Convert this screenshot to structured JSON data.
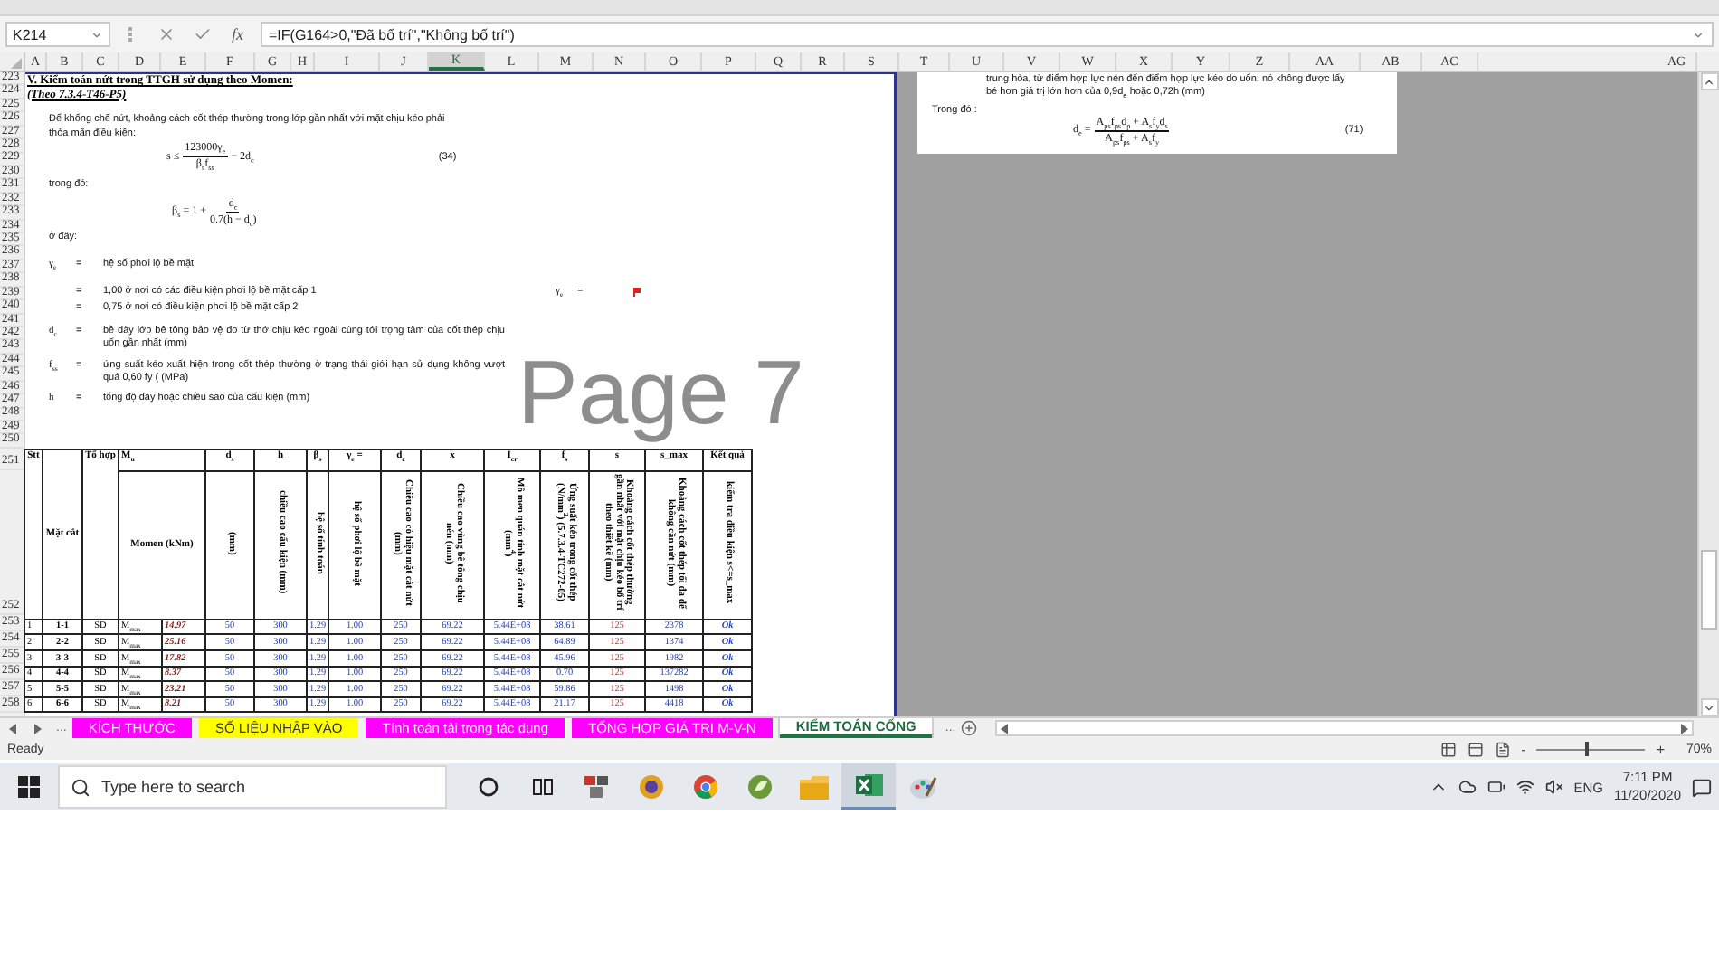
{
  "name_box": {
    "value": "K214"
  },
  "formula_bar": {
    "function_label": "fx",
    "formula": "=IF(G164>0,\"Đã bố trí\",\"Không bố trí\")"
  },
  "columns": [
    {
      "label": "A",
      "selected": false
    },
    {
      "label": "B",
      "selected": false
    },
    {
      "label": "C",
      "selected": false
    },
    {
      "label": "D",
      "selected": false
    },
    {
      "label": "E",
      "selected": false
    },
    {
      "label": "F",
      "selected": false
    },
    {
      "label": "G",
      "selected": false
    },
    {
      "label": "H",
      "selected": false
    },
    {
      "label": "I",
      "selected": false
    },
    {
      "label": "J",
      "selected": false
    },
    {
      "label": "K",
      "selected": true
    },
    {
      "label": "L",
      "selected": false
    },
    {
      "label": "M",
      "selected": false
    },
    {
      "label": "N",
      "selected": false
    },
    {
      "label": "O",
      "selected": false
    },
    {
      "label": "P",
      "selected": false
    },
    {
      "label": "Q",
      "selected": false
    },
    {
      "label": "R",
      "selected": false
    },
    {
      "label": "S",
      "selected": false
    },
    {
      "label": "T",
      "selected": false
    },
    {
      "label": "U",
      "selected": false
    },
    {
      "label": "V",
      "selected": false
    },
    {
      "label": "W",
      "selected": false
    },
    {
      "label": "X",
      "selected": false
    },
    {
      "label": "Y",
      "selected": false
    },
    {
      "label": "Z",
      "selected": false
    },
    {
      "label": "AA",
      "selected": false
    },
    {
      "label": "AB",
      "selected": false
    },
    {
      "label": "AC",
      "selected": false
    },
    {
      "label": "AG",
      "selected": false
    }
  ],
  "row_numbers": [
    "223",
    "224",
    "225",
    "226",
    "227",
    "228",
    "229",
    "230",
    "231",
    "232",
    "233",
    "234",
    "235",
    "236",
    "237",
    "238",
    "239",
    "240",
    "241",
    "242",
    "243",
    "244",
    "245",
    "246",
    "247",
    "248",
    "249",
    "250",
    "251",
    "252",
    "253",
    "254",
    "255",
    "256",
    "257",
    "258"
  ],
  "notes": [
    {
      "kind": "heading",
      "text": "V. Kiểm toán nứt trong TTGH sử dụng theo Momen:"
    },
    {
      "kind": "subheading",
      "text": "(Theo 7.3.4-T46-P5)"
    },
    {
      "kind": "paragraph",
      "text": "Để khống chế nứt, khoảng cách cốt thép thường trong lớp gần nhất với mặt chịu kéo phải"
    },
    {
      "kind": "paragraph",
      "text": "thỏa mãn điều kiện:"
    },
    {
      "kind": "formula",
      "lhs": "s ≤",
      "numerator": "123000γ$_{e}$",
      "denominator": "β$_{s}$f$_{ss}$",
      "rhs": "− 2d$_{c}$",
      "number": "(34)"
    },
    {
      "kind": "paragraph",
      "text": "trong đó:"
    },
    {
      "kind": "formula",
      "lhs": "β$_{s}$ = 1 +",
      "numerator": "d$_{c}$",
      "denominator": "0.7(h − d$_{c}$)"
    },
    {
      "kind": "paragraph",
      "text": "ở đây:"
    },
    {
      "kind": "definition",
      "symbol": "γ$_{e}$",
      "eq": "=",
      "text": "hệ số phơi lộ bề mặt"
    },
    {
      "kind": "definition",
      "eq": "=",
      "text": "1,00 ở nơi có các điều kiện phơi lộ bề mặt cấp 1",
      "side": {
        "symbol": "γ$_{e}$",
        "eq": "="
      }
    },
    {
      "kind": "definition",
      "eq": "=",
      "text": "0,75 ở nơi có điều kiện phơi lộ bề mặt cấp 2"
    },
    {
      "kind": "definition",
      "symbol": "d$_{c}$",
      "eq": "=",
      "text": "bề dày lớp bê tông bảo vệ đo từ thớ chịu kéo ngoài cùng tới trọng tâm của cốt thép chịu uốn gần nhất (mm)"
    },
    {
      "kind": "definition",
      "symbol": "f$_{ss}$",
      "eq": "=",
      "text": "ứng suất kéo xuất hiện trong cốt thép thường ở trạng thái giới hạn sử dụng không vượt quá 0,60 fy ( (MPa)"
    },
    {
      "kind": "definition",
      "symbol": "h",
      "eq": "=",
      "text": "tổng độ dày hoặc chiều sao của cấu kiện (mm)"
    }
  ],
  "page_label": "Page 7",
  "table": {
    "headers": [
      {
        "kind": "label",
        "symbol": "Stt"
      },
      {
        "kind": "title",
        "symbol": "Mặt cắt"
      },
      {
        "kind": "label",
        "symbol": "Tổ hợp"
      },
      {
        "kind": "merged",
        "symbol": "M$_{u}$",
        "description": "Momen (kNm)"
      },
      {
        "kind": "vertical",
        "symbol": "d$_{s}$",
        "description": "(mm)"
      },
      {
        "kind": "vertical",
        "symbol": "h",
        "description": "chiều cao cấu kiện (mm)"
      },
      {
        "kind": "vertical",
        "symbol": "β$_{s}$",
        "description": "hệ số tính toán"
      },
      {
        "kind": "vertical",
        "symbol": "γ$_{e}$ =",
        "description": "hệ số phơi lộ bề mặt"
      },
      {
        "kind": "vertical",
        "symbol": "d$_{c}$",
        "description": "Chiều cao có hiệu mặt cắt nứt (mm)"
      },
      {
        "kind": "vertical",
        "symbol": "x",
        "description": "Chiều cao vùng bê tông chịu nén (mm)"
      },
      {
        "kind": "vertical",
        "symbol": "I$_{cr}$",
        "description": "Mô men quán tính mặt cắt nứt (mm$^{4}$)"
      },
      {
        "kind": "vertical",
        "symbol": "f$_{s}$",
        "description": "Ứng suất kéo trong cốt thép (N/mm$^{2}$) (5.7.3.4-TC272-05)"
      },
      {
        "kind": "vertical",
        "symbol": "s",
        "description": "Khoảng cách cốt thép thường gần nhất với mặt chịu kéo bố trí theo thiết kế (mm)"
      },
      {
        "kind": "vertical",
        "symbol": "s_max",
        "description": "Khoảng cách cốt thép tối đa để không cần nứt (mm)"
      },
      {
        "kind": "vertical",
        "symbol": "Kết quả",
        "description": "kiểm tra điều kiện s<=s_max"
      }
    ],
    "rows": [
      [
        "1",
        "1-1",
        "SD",
        "M$_{max}$",
        "14.97",
        "50",
        "300",
        "1.29",
        "1.00",
        "250",
        "69.22",
        "5.44E+08",
        "38.61",
        "125",
        "2378",
        "Ok"
      ],
      [
        "2",
        "2-2",
        "SD",
        "M$_{max}$",
        "25.16",
        "50",
        "300",
        "1.29",
        "1.00",
        "250",
        "69.22",
        "5.44E+08",
        "64.89",
        "125",
        "1374",
        "Ok"
      ],
      [
        "3",
        "3-3",
        "SD",
        "M$_{max}$",
        "17.82",
        "50",
        "300",
        "1.29",
        "1.00",
        "250",
        "69.22",
        "5.44E+08",
        "45.96",
        "125",
        "1982",
        "Ok"
      ],
      [
        "4",
        "4-4",
        "SD",
        "M$_{max}$",
        "8.37",
        "50",
        "300",
        "1.29",
        "1.00",
        "250",
        "69.22",
        "5.44E+08",
        "0.70",
        "125",
        "137282",
        "Ok"
      ],
      [
        "5",
        "5-5",
        "SD",
        "M$_{max}$",
        "23.21",
        "50",
        "300",
        "1.29",
        "1.00",
        "250",
        "69.22",
        "5.44E+08",
        "59.86",
        "125",
        "1498",
        "Ok"
      ],
      [
        "6",
        "6-6",
        "SD",
        "M$_{max}$",
        "8.21",
        "50",
        "300",
        "1.29",
        "1.00",
        "250",
        "69.22",
        "5.44E+08",
        "21.17",
        "125",
        "4418",
        "Ok"
      ]
    ]
  },
  "side_page": {
    "lines": [
      "trung hòa, từ điểm hợp lực nén đến điểm hợp lực kéo do uốn; nó không được lấy",
      "bé hơn giá trị lớn hơn của 0,9d$_{e}$ hoặc 0,72h (mm)"
    ],
    "label": "Trong đó :",
    "formula": {
      "lhs": "d$_{e}$ =",
      "numerator": "A$_{ps}$f$_{ps}$d$_{p}$ + A$_{s}$f$_{y}$d$_{s}$",
      "denominator": "A$_{ps}$f$_{ps}$ + A$_{s}$f$_{y}$",
      "number": "(71)"
    }
  },
  "sheet_tabs": {
    "more_left": "...",
    "more_right": "...",
    "tabs": [
      {
        "label": "KÍCH THƯỚC",
        "color": "#ff00ff",
        "selected": false
      },
      {
        "label": "SỐ LIỆU NHẬP VÀO",
        "color": "#ffff00",
        "selected": false
      },
      {
        "label": "Tính toán tải trọng tác dụng",
        "color": "#ff00ff",
        "selected": false
      },
      {
        "label": "TỔNG HỢP GIÁ TRỊ M-V-N",
        "color": "#ff00ff",
        "selected": false
      },
      {
        "label": "KIỂM TOÁN CỐNG",
        "color": "#ffffff",
        "selected": true
      }
    ]
  },
  "status_bar": {
    "text": "Ready",
    "zoom_minus": "-",
    "zoom_plus": "+",
    "level": 0.45,
    "reading": "70%"
  },
  "taskbar": {
    "search_placeholder": "Type here to search",
    "apps": [
      {
        "kind": "ring",
        "selected": false
      },
      {
        "kind": "taskview",
        "selected": false
      },
      {
        "kind": "tiles",
        "selected": false
      },
      {
        "kind": "globe",
        "selected": false
      },
      {
        "kind": "chrome",
        "selected": false
      },
      {
        "kind": "leaf",
        "selected": false
      },
      {
        "kind": "folder",
        "selected": false
      },
      {
        "kind": "excel",
        "selected": true
      },
      {
        "kind": "paint",
        "selected": false
      }
    ],
    "language": "ENG",
    "time": "7:11 PM",
    "date": "11/20/2020"
  }
}
